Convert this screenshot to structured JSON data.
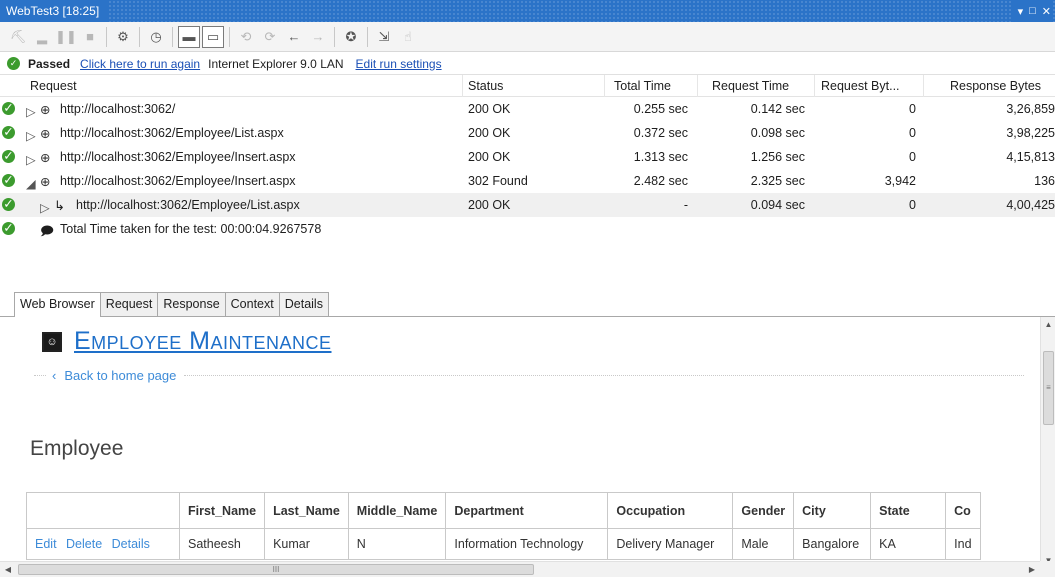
{
  "window": {
    "title": "WebTest3 [18:25]",
    "controls": [
      "▾",
      "□",
      "✕"
    ]
  },
  "toolbar": {
    "icons": [
      "run-icon",
      "step-icon",
      "pause-icon",
      "stop-icon",
      "parameterize-icon",
      "clock-icon",
      "show-toolbar-icon",
      "toggle-details-icon",
      "add-recording-icon",
      "set-request-icon",
      "back-arrow-icon",
      "forward-arrow-icon",
      "performance-session-icon",
      "export-icon",
      "context-icon"
    ]
  },
  "status": {
    "result": "Passed",
    "run_again_link": "Click here to run again",
    "browser": "Internet Explorer 9.0",
    "network": "LAN",
    "edit_link": "Edit run settings"
  },
  "grid": {
    "headers": {
      "request": "Request",
      "status": "Status",
      "total_time": "Total Time",
      "request_time": "Request Time",
      "request_bytes": "Request Byt...",
      "response_bytes": "Response Bytes"
    },
    "rows": [
      {
        "url": "http://localhost:3062/",
        "status": "200 OK",
        "total_time": "0.255 sec",
        "request_time": "0.142 sec",
        "request_bytes": "0",
        "response_bytes": "3,26,859",
        "expander": "▷"
      },
      {
        "url": "http://localhost:3062/Employee/List.aspx",
        "status": "200 OK",
        "total_time": "0.372 sec",
        "request_time": "0.098 sec",
        "request_bytes": "0",
        "response_bytes": "3,98,225",
        "expander": "▷"
      },
      {
        "url": "http://localhost:3062/Employee/Insert.aspx",
        "status": "200 OK",
        "total_time": "1.313 sec",
        "request_time": "1.256 sec",
        "request_bytes": "0",
        "response_bytes": "4,15,813",
        "expander": "▷"
      },
      {
        "url": "http://localhost:3062/Employee/Insert.aspx",
        "status": "302 Found",
        "total_time": "2.482 sec",
        "request_time": "2.325 sec",
        "request_bytes": "3,942",
        "response_bytes": "136",
        "expander": "◢"
      },
      {
        "url": "http://localhost:3062/Employee/List.aspx",
        "status": "200 OK",
        "total_time": "-",
        "request_time": "0.094 sec",
        "request_bytes": "0",
        "response_bytes": "4,00,425",
        "expander": "▷"
      }
    ],
    "total_row": "Total Time taken for the test: 00:00:04.9267578"
  },
  "tabs": [
    "Web Browser",
    "Request",
    "Response",
    "Context",
    "Details"
  ],
  "browser": {
    "page_title": "Employee Maintenance",
    "back_link": "Back to home page",
    "section_title": "Employee",
    "table": {
      "headers": [
        "",
        "First_Name",
        "Last_Name",
        "Middle_Name",
        "Department",
        "Occupation",
        "Gender",
        "City",
        "State",
        "Co"
      ],
      "rows": [
        {
          "actions": [
            "Edit",
            "Delete",
            "Details"
          ],
          "cells": [
            "Satheesh",
            "Kumar",
            "N",
            "Information Technology",
            "Delivery Manager",
            "Male",
            "Bangalore",
            "KA",
            "Ind"
          ]
        }
      ]
    }
  },
  "colors": {
    "titlebar": "#2b73c8",
    "link": "#1a4fb5",
    "page_link": "#3d8bd8",
    "pass_green": "#3c9b2e"
  }
}
